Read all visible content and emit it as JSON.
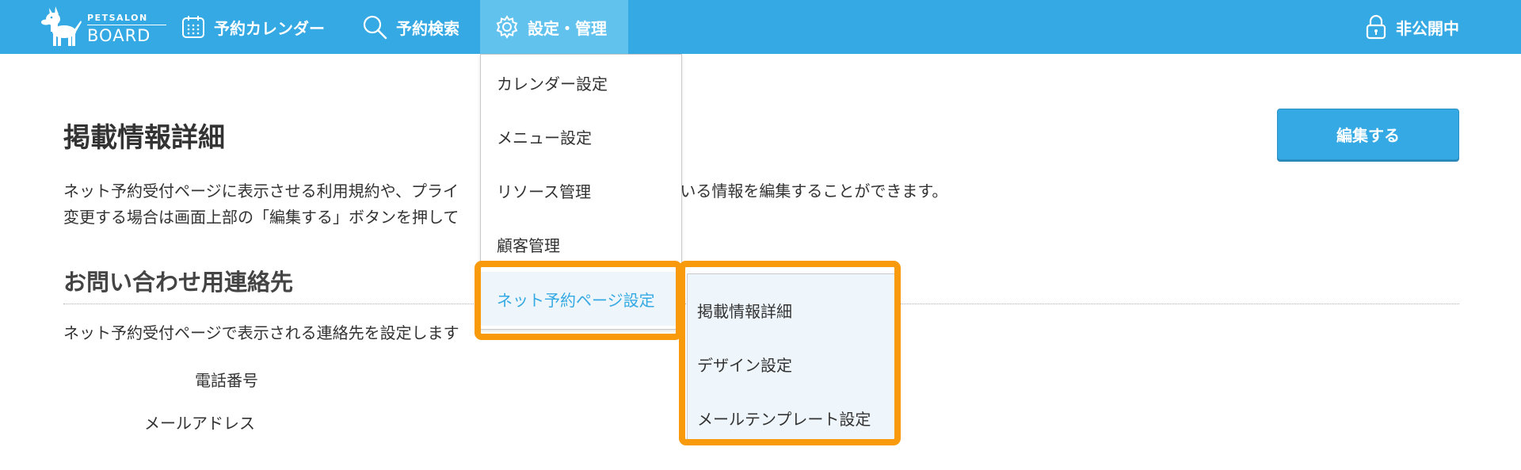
{
  "brand": {
    "small": "PETSALON",
    "big": "BOARD"
  },
  "nav": {
    "calendar": "予約カレンダー",
    "search": "予約検索",
    "settings": "設定・管理",
    "visibility": "非公開中"
  },
  "main": {
    "title": "掲載情報詳細",
    "description_line1": "ネット予約受付ページに表示させる利用規約や、プライ　　　　　　　　　　定されている情報を編集することができます。",
    "description_line2": "変更する場合は画面上部の「編集する」ボタンを押して",
    "edit_button": "編集する",
    "section_title": "お問い合わせ用連絡先",
    "section_desc": "ネット予約受付ページで表示される連絡先を設定します",
    "fields": {
      "phone": "電話番号",
      "email": "メールアドレス"
    }
  },
  "dropdown": {
    "items": [
      "カレンダー設定",
      "メニュー設定",
      "リソース管理",
      "顧客管理",
      "ネット予約ページ設定"
    ],
    "active_index": 4
  },
  "submenu": {
    "items": [
      "掲載情報詳細",
      "デザイン設定",
      "メールテンプレート設定"
    ]
  },
  "icons": {
    "logo": "dog-logo-icon",
    "calendar": "calendar-icon",
    "search": "search-icon",
    "settings": "gear-icon",
    "lock": "lock-icon"
  },
  "colors": {
    "primary": "#35a9e3",
    "nav_active": "#62c2ee",
    "highlight": "#f89a0b",
    "submenu_bg": "#eef6fb"
  }
}
